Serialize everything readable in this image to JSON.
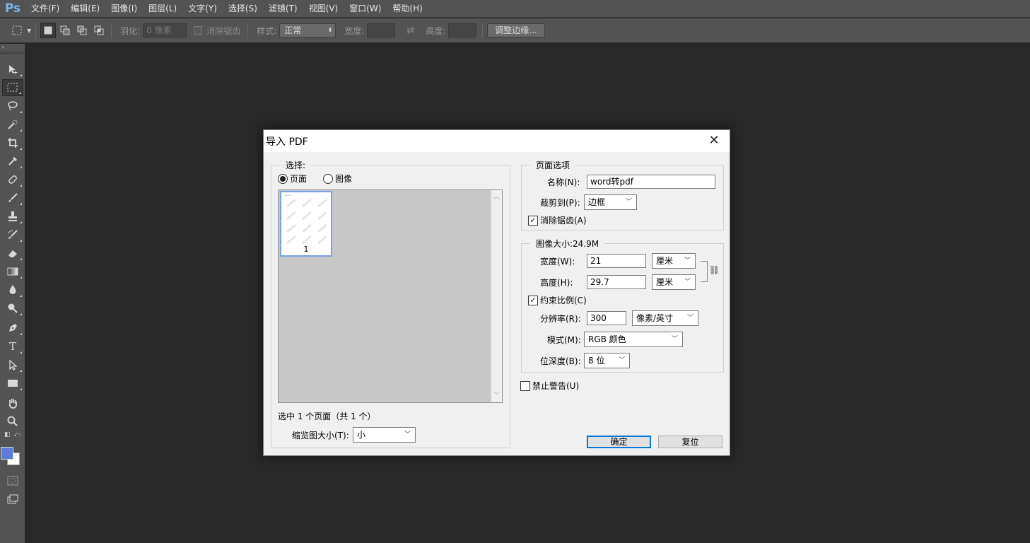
{
  "app": {
    "logo": "Ps",
    "menu": [
      "文件(F)",
      "编辑(E)",
      "图像(I)",
      "图层(L)",
      "文字(Y)",
      "选择(S)",
      "滤镜(T)",
      "视图(V)",
      "窗口(W)",
      "帮助(H)"
    ]
  },
  "options_bar": {
    "feather_label": "羽化:",
    "feather_placeholder": "0 像素",
    "antialias_label": "消除锯齿",
    "style_label": "样式:",
    "style_value": "正常",
    "width_label": "宽度:",
    "height_label": "高度:",
    "refine_edge_label": "调整边缘..."
  },
  "toolbox": {
    "foreground_color": "#5b7dd8",
    "background_color": "#ffffff"
  },
  "dialog": {
    "title": "导入 PDF",
    "close_glyph": "✕",
    "select_group": {
      "legend": "选择:",
      "option_page": "页面",
      "option_image": "图像",
      "selected": "页面",
      "thumbnail_page_number": "1",
      "selection_status": "选中 1 个页面（共 1 个）",
      "thumb_size_label": "缩览图大小(T):",
      "thumb_size_value": "小"
    },
    "page_options": {
      "legend": "页面选项",
      "name_label": "名称(N):",
      "name_value": "word转pdf",
      "crop_label": "裁剪到(P):",
      "crop_value": "边框",
      "antialias_label": "消除锯齿(A)",
      "antialias_checked": true
    },
    "image_size": {
      "legend": "图像大小:24.9M",
      "width_label": "宽度(W):",
      "width_value": "21",
      "width_unit": "厘米",
      "height_label": "高度(H):",
      "height_value": "29.7",
      "height_unit": "厘米",
      "constrain_label": "约束比例(C)",
      "constrain_checked": true,
      "resolution_label": "分辨率(R):",
      "resolution_value": "300",
      "resolution_unit": "像素/英寸",
      "mode_label": "模式(M):",
      "mode_value": "RGB 颜色",
      "bit_depth_label": "位深度(B):",
      "bit_depth_value": "8 位"
    },
    "suppress_warnings_label": "禁止警告(U)",
    "suppress_warnings_checked": false,
    "ok_label": "确定",
    "reset_label": "复位"
  }
}
